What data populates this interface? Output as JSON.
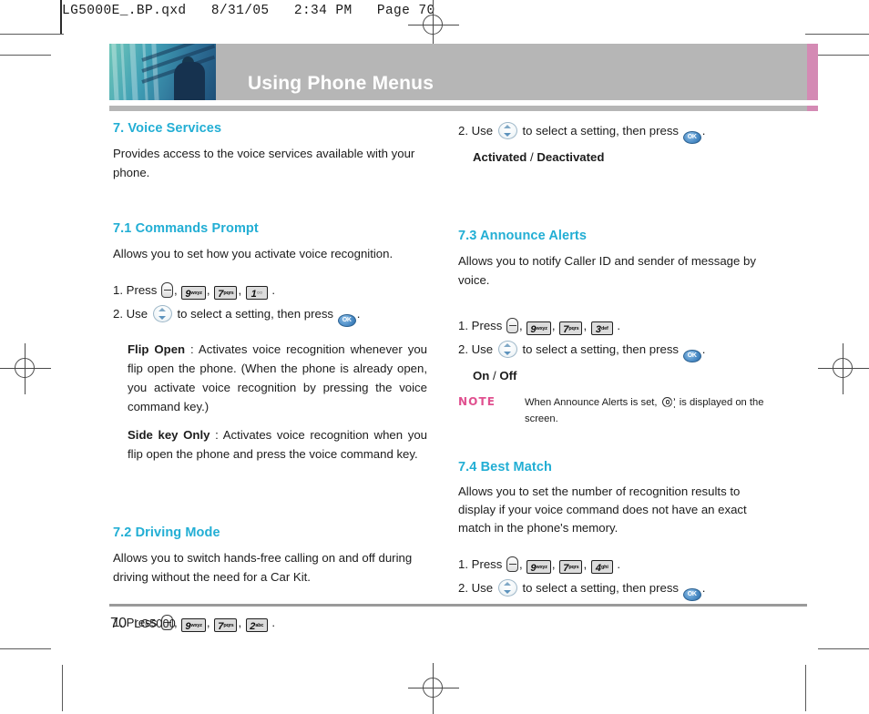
{
  "prepress": {
    "file_stamp": "LG5000E_.BP.qxd   8/31/05   2:34 PM   Page 70"
  },
  "banner": {
    "title": "Using Phone Menus",
    "photo_alt": "architectural-photo",
    "bar_color": "#b6b6b6",
    "accent_color": "#d48ab4"
  },
  "theme": {
    "heading_color": "#22aed4",
    "note_color": "#e0508f",
    "text_color": "#1c1c1c"
  },
  "left_column": {
    "section_main": {
      "heading": "7. Voice Services",
      "body": "Provides access to the voice services available with your phone."
    },
    "section_71": {
      "heading": "7.1 Commands Prompt",
      "body": "Allows you to set how you activate voice recognition.",
      "step1_prefix": "1. Press",
      "step1_keys": [
        {
          "digit": "9",
          "letters": "wxyz"
        },
        {
          "digit": "7",
          "letters": "pqrs"
        },
        {
          "digit": "1",
          "letters": "○○"
        }
      ],
      "step2_prefix": "2. Use",
      "step2_mid": "to select a setting, then press",
      "step2_suffix": ".",
      "define1_term": "Flip Open",
      "define1_text": " : Activates voice recognition whenever you flip open the phone. (When the phone is already open, you activate voice recognition by pressing the voice command key.)",
      "define2_term": "Side key Only",
      "define2_text": " : Activates voice recognition when you flip open the phone and press the voice command key."
    },
    "section_72": {
      "heading": "7.2 Driving Mode",
      "body": "Allows you to switch hands-free calling on and off during driving without the need for a Car Kit.",
      "step1_prefix": "1. Press",
      "step1_keys": [
        {
          "digit": "9",
          "letters": "wxyz"
        },
        {
          "digit": "7",
          "letters": "pqrs"
        },
        {
          "digit": "2",
          "letters": "abc"
        }
      ]
    }
  },
  "right_column": {
    "section_72_cont": {
      "step2_prefix": "2. Use",
      "step2_mid": "to select a setting, then press",
      "step2_suffix": ".",
      "options": "Activated / Deactivated",
      "option_a": "Activated",
      "option_sep": " / ",
      "option_b": "Deactivated"
    },
    "section_73": {
      "heading": "7.3 Announce Alerts",
      "body": "Allows you to notify Caller ID and sender of message by voice.",
      "step1_prefix": "1. Press",
      "step1_keys": [
        {
          "digit": "9",
          "letters": "wxyz"
        },
        {
          "digit": "7",
          "letters": "pqrs"
        },
        {
          "digit": "3",
          "letters": "def"
        }
      ],
      "step2_prefix": "2. Use",
      "step2_mid": "to select a setting, then press",
      "step2_suffix": ".",
      "option_a": "On",
      "option_sep": " / ",
      "option_b": "Off",
      "note_label": "NOTE",
      "note_text_before": "When Announce Alerts is set,",
      "note_text_after": "is displayed on the screen."
    },
    "section_74": {
      "heading": "7.4 Best Match",
      "body": "Allows you to set the number of recognition results to display if your voice command does not have an exact match in the phone's memory.",
      "step1_prefix": "1. Press",
      "step1_keys": [
        {
          "digit": "9",
          "letters": "wxyz"
        },
        {
          "digit": "7",
          "letters": "pqrs"
        },
        {
          "digit": "4",
          "letters": "ghi"
        }
      ],
      "step2_prefix": "2. Use",
      "step2_mid": "to select a setting, then press",
      "step2_suffix": "."
    }
  },
  "footer": {
    "page_number": "70",
    "model": "LG5000"
  },
  "icons": {
    "menu_key": "menu-key-icon",
    "nav_ring": "navigation-ring-icon",
    "ok_key": "OK",
    "speaker": "speaker-icon"
  }
}
